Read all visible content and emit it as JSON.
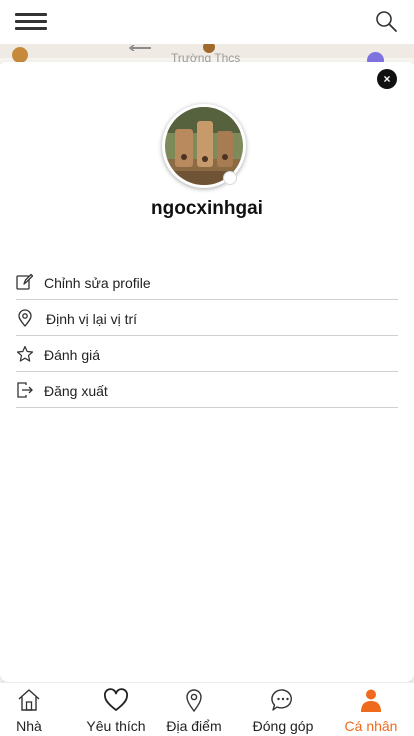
{
  "header": {
    "menu_icon": "hamburger-menu-icon",
    "search_icon": "search-icon"
  },
  "map": {
    "label": "Trường Thcs"
  },
  "profile": {
    "close_label": "×",
    "username": "ngocxinhgai"
  },
  "menu": {
    "items": [
      {
        "label": "Chỉnh sửa profile",
        "icon": "edit-icon"
      },
      {
        "label": "Định vị lại vị trí",
        "icon": "location-pin-icon"
      },
      {
        "label": "Đánh giá",
        "icon": "star-icon"
      },
      {
        "label": "Đăng xuất",
        "icon": "logout-icon"
      }
    ]
  },
  "nav": {
    "items": [
      {
        "label": "Nhà",
        "icon": "home-icon"
      },
      {
        "label": "Yêu thích",
        "icon": "heart-icon"
      },
      {
        "label": "Địa điểm",
        "icon": "map-pin-icon"
      },
      {
        "label": "Đóng góp",
        "icon": "chat-bubble-icon"
      },
      {
        "label": "Cá nhân",
        "icon": "user-icon"
      }
    ],
    "active": "Cá nhân",
    "accent_color": "#f06a1e"
  }
}
